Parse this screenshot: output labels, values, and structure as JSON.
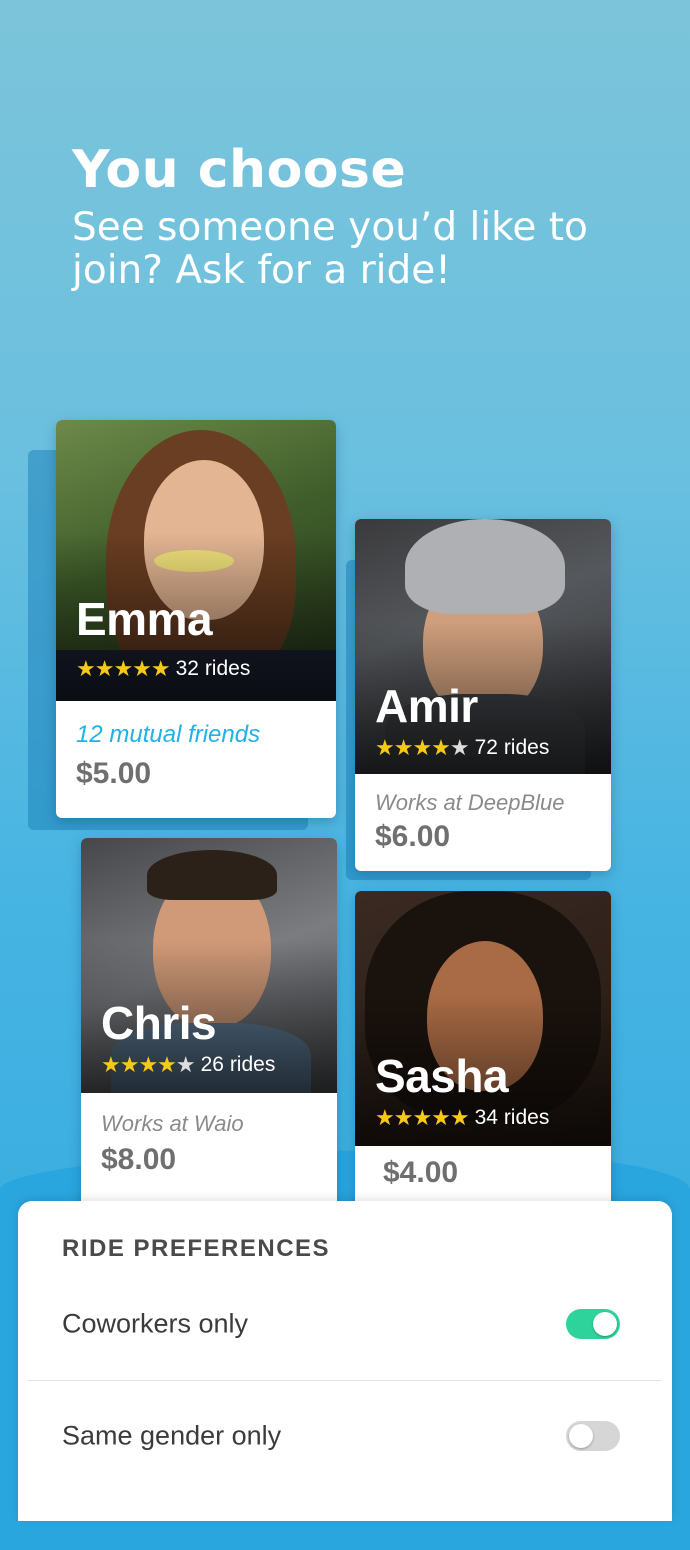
{
  "header": {
    "title": "You choose",
    "subtitle": "See someone you’d like to join? Ask for a ride!"
  },
  "cards": {
    "emma": {
      "name": "Emma",
      "stars": "★★★★★",
      "rides": "32 rides",
      "detail": "12 mutual friends",
      "price": "$5.00"
    },
    "amir": {
      "name": "Amir",
      "stars": "★★★★",
      "rides": "72 rides",
      "detail": "Works at DeepBlue",
      "price": "$6.00"
    },
    "chris": {
      "name": "Chris",
      "stars": "★★★★",
      "rides": "26 rides",
      "detail": "Works at Waio",
      "price": "$8.00"
    },
    "sasha": {
      "name": "Sasha",
      "stars": "★★★★★",
      "rides": "34 rides",
      "price": "$4.00"
    }
  },
  "preferences": {
    "title": "RIDE PREFERENCES",
    "items": [
      {
        "label": "Coworkers only",
        "enabled": true
      },
      {
        "label": "Same gender only",
        "enabled": false
      }
    ]
  },
  "colors": {
    "accent": "#20b1e6",
    "toggle_on": "#2ed39b",
    "toggle_off": "#d6d6d6",
    "star": "#f6c818"
  }
}
